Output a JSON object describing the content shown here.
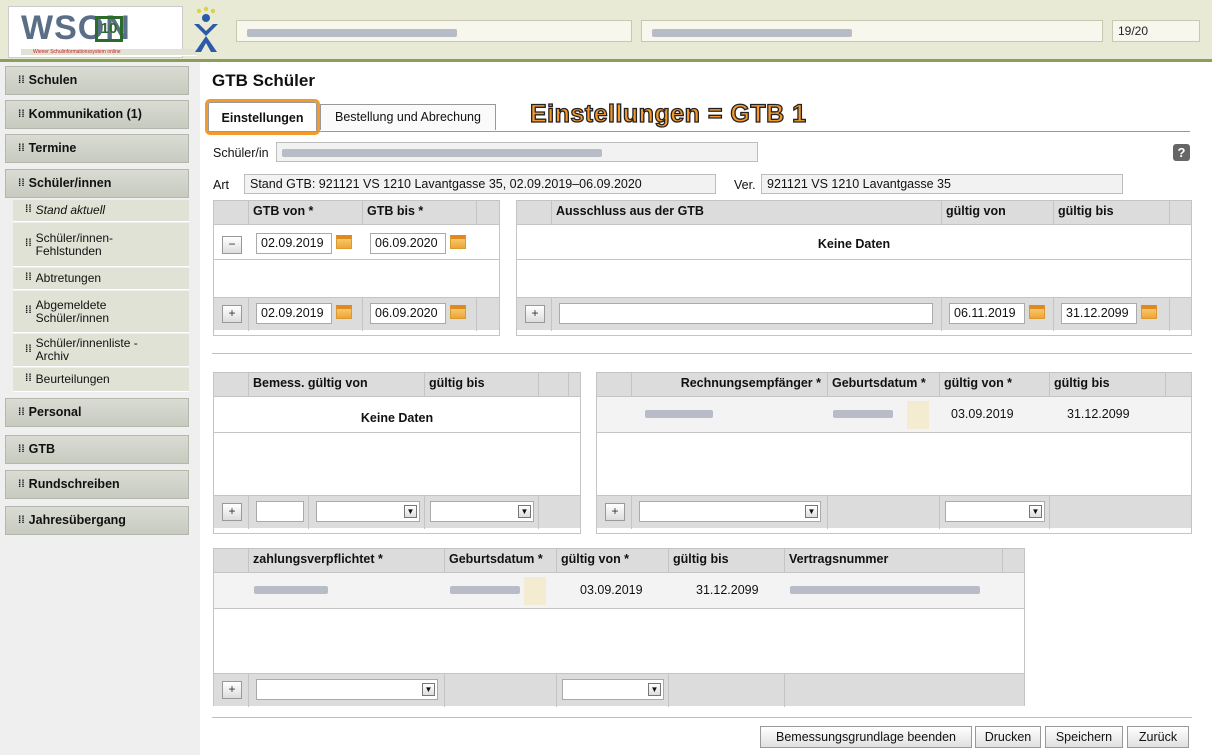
{
  "header": {
    "logo_text": "WSON",
    "logo_num": "10",
    "logo_sub": "Wiener Schulinformationssystem online",
    "school_year": "19/20"
  },
  "sidebar": {
    "items": [
      {
        "label": "Schulen"
      },
      {
        "label": "Kommunikation (1)"
      },
      {
        "label": "Termine"
      },
      {
        "label": "Schüler/innen"
      },
      {
        "label": "Personal"
      },
      {
        "label": "GTB"
      },
      {
        "label": "Rundschreiben"
      },
      {
        "label": "Jahresübergang"
      }
    ],
    "sub_items": [
      {
        "label": "Stand aktuell"
      },
      {
        "label": "Schüler/innen-Fehlstunden"
      },
      {
        "label": "Abtretungen"
      },
      {
        "label": "Abgemeldete Schüler/innen"
      },
      {
        "label": "Schüler/innenliste - Archiv"
      },
      {
        "label": "Beurteilungen"
      }
    ]
  },
  "main": {
    "title": "GTB Schüler",
    "tabs": [
      {
        "label": "Einstellungen"
      },
      {
        "label": "Bestellung und Abrechung"
      }
    ],
    "annotation": "Einstellungen = GTB 1",
    "schueler_label": "Schüler/in",
    "art_label": "Art",
    "art_value": "Stand GTB:  921121 VS 1210 Lavantgasse 35, 02.09.2019–06.09.2020",
    "ver_label": "Ver.",
    "ver_value": "921121 VS 1210 Lavantgasse 35",
    "help": "?"
  },
  "gtb_grid": {
    "headers": [
      "GTB von *",
      "GTB bis *"
    ],
    "row": {
      "von": "02.09.2019",
      "bis": "06.09.2020"
    },
    "new": {
      "von": "02.09.2019",
      "bis": "06.09.2020"
    },
    "minus": "−",
    "plus": "+"
  },
  "ausschluss_grid": {
    "headers": [
      "Ausschluss aus der GTB",
      "gültig von",
      "gültig bis"
    ],
    "nodata": "Keine Daten",
    "new": {
      "von": "06.11.2019",
      "bis": "31.12.2099"
    },
    "plus": "+"
  },
  "bemess_grid": {
    "headers": [
      "Bemess. gültig von",
      "gültig bis"
    ],
    "nodata": "Keine Daten",
    "plus": "+"
  },
  "rechnung_grid": {
    "headers": [
      "Rechnungsempfänger *",
      "Geburtsdatum *",
      "gültig von *",
      "gültig bis"
    ],
    "row": {
      "von": "03.09.2019",
      "bis": "31.12.2099"
    },
    "plus": "+"
  },
  "zahlung_grid": {
    "headers": [
      "zahlungsverpflichtet *",
      "Geburtsdatum *",
      "gültig von *",
      "gültig bis",
      "Vertragsnummer"
    ],
    "row": {
      "von": "03.09.2019",
      "bis": "31.12.2099"
    },
    "plus": "+"
  },
  "buttons": {
    "bemessung_beenden": "Bemessungsgrundlage beenden",
    "drucken": "Drucken",
    "speichern": "Speichern",
    "zurueck": "Zurück"
  },
  "icons": {
    "calendar": "calendar-icon",
    "dropdown": "chevron-down-icon"
  },
  "colors": {
    "accent_orange": "#f49a2d",
    "header_bar": "#8a9f5c"
  }
}
